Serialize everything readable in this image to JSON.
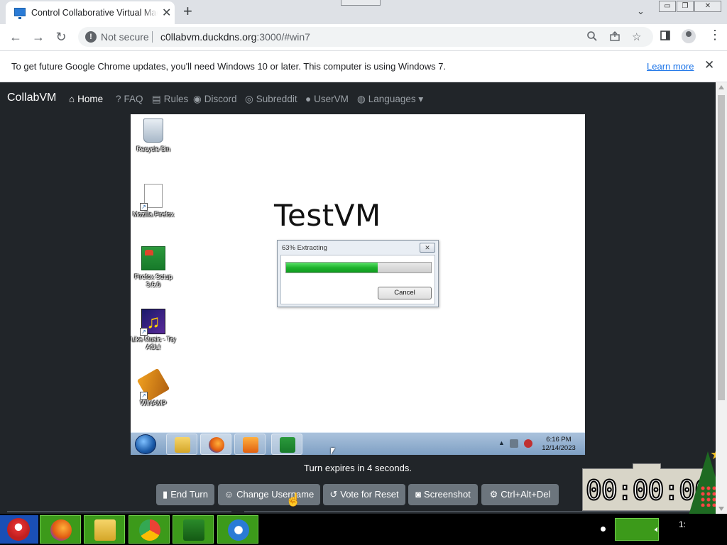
{
  "browser": {
    "tab_title": "Control Collaborative Virtual Machine",
    "tab_close": "✕",
    "new_tab": "+",
    "tab_search": "⌄",
    "win_controls": [
      "▭",
      "❐",
      "✕"
    ],
    "not_secure": "Not secure",
    "url_host": "c0llabvm.duckdns.org",
    "url_rest": ":3000/#win7",
    "nav": {
      "back": "←",
      "forward": "→",
      "reload": "↻"
    },
    "icons": {
      "zoom": "zoom-icon",
      "share": "share-icon",
      "star": "☆",
      "sidepanel": "▯",
      "menu": "⋮"
    }
  },
  "infobar": {
    "text": "To get future Google Chrome updates, you'll need Windows 10 or later. This computer is using Windows 7.",
    "link": "Learn more",
    "close": "✕"
  },
  "site": {
    "brand": "CollabVM",
    "nav": [
      {
        "icon": "⌂",
        "label": "Home"
      },
      {
        "icon": "?",
        "label": "FAQ"
      },
      {
        "icon": "▤",
        "label": "Rules"
      },
      {
        "icon": "◉",
        "label": "Discord"
      },
      {
        "icon": "◎",
        "label": "Subreddit"
      },
      {
        "icon": "●",
        "label": "UserVM"
      },
      {
        "icon": "◍",
        "label": "Languages ▾"
      }
    ],
    "turn_text": "Turn expires in 4 seconds.",
    "buttons": [
      {
        "icon": "▮",
        "label": "End Turn"
      },
      {
        "icon": "☺",
        "label": "Change Username"
      },
      {
        "icon": "↺",
        "label": "Vote for Reset"
      },
      {
        "icon": "◙",
        "label": "Screenshot"
      },
      {
        "icon": "⚙",
        "label": "Ctrl+Alt+Del"
      }
    ]
  },
  "vm": {
    "desktop_title": "TestVM",
    "desktop_icons": [
      {
        "label": "Recycle Bin",
        "icon": "recycle-bin-icon"
      },
      {
        "label": "Mozilla Firefox",
        "icon": "firefox-shortcut-icon"
      },
      {
        "label": "Firefox Setup 3.6.0",
        "icon": "firefox-setup-icon"
      },
      {
        "label": "Like Music - Try AOL!",
        "icon": "like-music-icon"
      },
      {
        "label": "WINAMP",
        "icon": "winamp-icon"
      }
    ],
    "dialog": {
      "title": "63% Extracting",
      "close": "✕",
      "progress_pct": 63,
      "cancel": "Cancel"
    },
    "taskbar": {
      "tray_up": "▲",
      "time": "6:16 PM",
      "date": "12/14/2023"
    }
  },
  "timer": {
    "digits": "00:00:00"
  },
  "host": {
    "clock": "1:"
  },
  "colors": {
    "page_bg": "#212529",
    "button_bg": "#6c757d",
    "progress_green": "#1fb32e",
    "link_blue": "#1a73e8"
  }
}
